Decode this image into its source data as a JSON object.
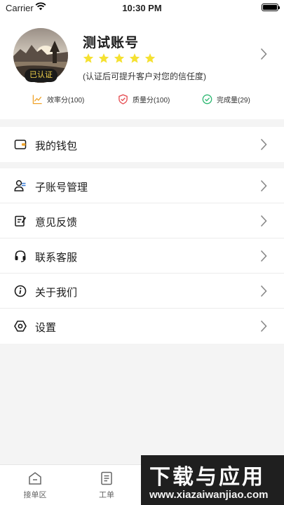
{
  "status_bar": {
    "carrier": "Carrier",
    "time": "10:30 PM"
  },
  "profile": {
    "name": "测试账号",
    "verified_badge": "已认证",
    "rating": 5,
    "verify_tip": "(认证后可提升客户对您的信任度)",
    "star_color": "#f5e131",
    "stats": [
      {
        "label": "效率分(100)",
        "icon": "trend-chart-icon",
        "color": "#f0a32a"
      },
      {
        "label": "质量分(100)",
        "icon": "shield-icon",
        "color": "#e5484d"
      },
      {
        "label": "完成量(29)",
        "icon": "check-circle-icon",
        "color": "#2eb872"
      }
    ]
  },
  "menu": {
    "wallet": "我的钱包",
    "items": [
      {
        "label": "子账号管理",
        "icon": "sub-account-icon"
      },
      {
        "label": "意见反馈",
        "icon": "feedback-icon"
      },
      {
        "label": "联系客服",
        "icon": "headset-icon"
      },
      {
        "label": "关于我们",
        "icon": "info-icon"
      },
      {
        "label": "设置",
        "icon": "settings-icon"
      }
    ]
  },
  "tabbar": {
    "tabs": [
      {
        "label": "接单区",
        "icon": "order-zone-icon"
      },
      {
        "label": "工单",
        "icon": "work-order-icon"
      }
    ]
  },
  "watermark": {
    "title": "下载与应用",
    "url": "www.xiazaiwanjiao.com"
  }
}
